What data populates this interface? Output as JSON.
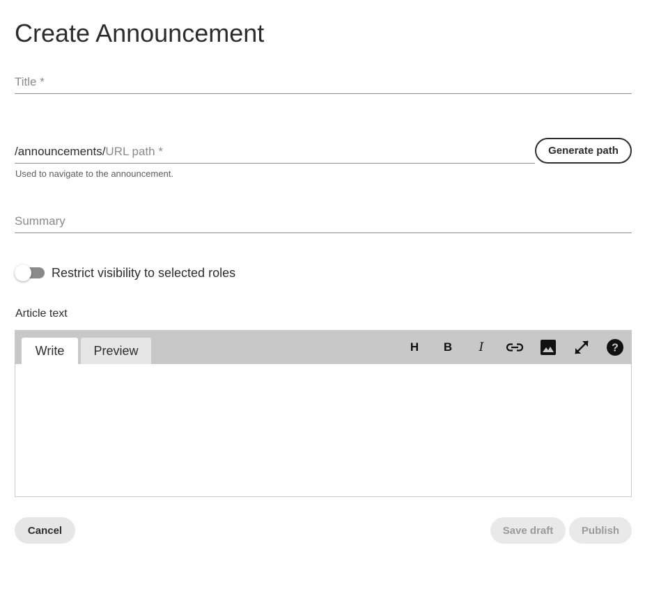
{
  "page": {
    "title": "Create Announcement"
  },
  "form": {
    "title_placeholder": "Title *",
    "title_value": "",
    "url_prefix": "/announcements/",
    "url_placeholder": "URL path *",
    "url_value": "",
    "generate_path_label": "Generate path",
    "url_help": "Used to navigate to the announcement.",
    "summary_placeholder": "Summary",
    "summary_value": "",
    "restrict_toggle_label": "Restrict visibility to selected roles",
    "restrict_toggle_on": false,
    "article_label": "Article text"
  },
  "editor": {
    "tabs": [
      {
        "label": "Write",
        "active": true
      },
      {
        "label": "Preview",
        "active": false
      }
    ],
    "tools": [
      {
        "icon": "heading-icon",
        "glyph": "H"
      },
      {
        "icon": "bold-icon",
        "glyph": "B"
      },
      {
        "icon": "italic-icon",
        "glyph": "I"
      },
      {
        "icon": "link-icon"
      },
      {
        "icon": "image-icon"
      },
      {
        "icon": "fullscreen-icon"
      },
      {
        "icon": "help-icon"
      }
    ],
    "content": ""
  },
  "actions": {
    "cancel_label": "Cancel",
    "save_draft_label": "Save draft",
    "publish_label": "Publish"
  },
  "colors": {
    "text": "#2c2c2c",
    "toolbar_bg": "#c8c8c8",
    "disabled_text": "#9a9a9a",
    "button_bg": "#e6e6e6"
  }
}
